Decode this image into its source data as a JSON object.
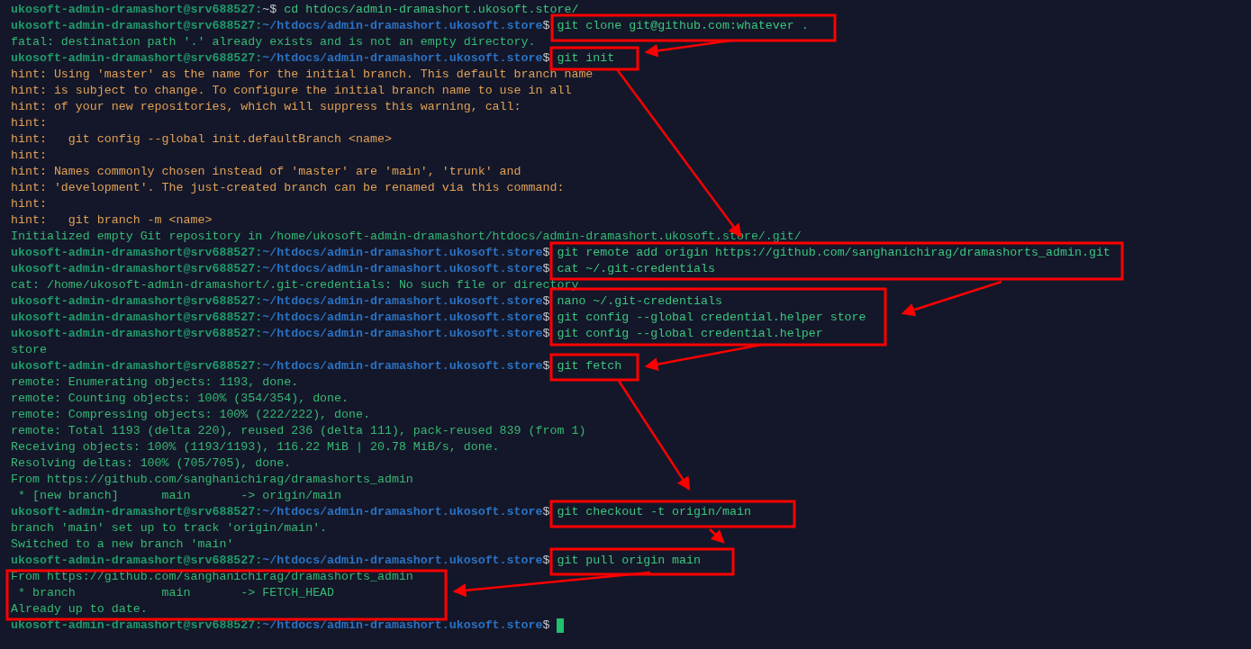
{
  "terminal": {
    "lines": [
      {
        "kind": "prompt",
        "user": "ukosoft-admin-dramashort@srv688527:",
        "path": "~",
        "symbol": "$",
        "command": "cd htdocs/admin-dramashort.ukosoft.store/"
      },
      {
        "kind": "prompt",
        "user": "ukosoft-admin-dramashort@srv688527:",
        "path": "~/htdocs/admin-dramashort.ukosoft.store",
        "symbol": "$",
        "command": "git clone git@github.com:whatever ."
      },
      {
        "kind": "output",
        "text": "fatal: destination path '.' already exists and is not an empty directory."
      },
      {
        "kind": "prompt",
        "user": "ukosoft-admin-dramashort@srv688527:",
        "path": "~/htdocs/admin-dramashort.ukosoft.store",
        "symbol": "$",
        "command": "git init"
      },
      {
        "kind": "hint",
        "text": "hint: Using 'master' as the name for the initial branch. This default branch name"
      },
      {
        "kind": "hint",
        "text": "hint: is subject to change. To configure the initial branch name to use in all"
      },
      {
        "kind": "hint",
        "text": "hint: of your new repositories, which will suppress this warning, call:"
      },
      {
        "kind": "hint",
        "text": "hint:"
      },
      {
        "kind": "hint",
        "text": "hint:   git config --global init.defaultBranch <name>"
      },
      {
        "kind": "hint",
        "text": "hint:"
      },
      {
        "kind": "hint",
        "text": "hint: Names commonly chosen instead of 'master' are 'main', 'trunk' and"
      },
      {
        "kind": "hint",
        "text": "hint: 'development'. The just-created branch can be renamed via this command:"
      },
      {
        "kind": "hint",
        "text": "hint:"
      },
      {
        "kind": "hint",
        "text": "hint:   git branch -m <name>"
      },
      {
        "kind": "output",
        "text": "Initialized empty Git repository in /home/ukosoft-admin-dramashort/htdocs/admin-dramashort.ukosoft.store/.git/"
      },
      {
        "kind": "prompt",
        "user": "ukosoft-admin-dramashort@srv688527:",
        "path": "~/htdocs/admin-dramashort.ukosoft.store",
        "symbol": "$",
        "command": "git remote add origin https://github.com/sanghanichirag/dramashorts_admin.git"
      },
      {
        "kind": "prompt",
        "user": "ukosoft-admin-dramashort@srv688527:",
        "path": "~/htdocs/admin-dramashort.ukosoft.store",
        "symbol": "$",
        "command": "cat ~/.git-credentials"
      },
      {
        "kind": "output",
        "text": "cat: /home/ukosoft-admin-dramashort/.git-credentials: No such file or directory"
      },
      {
        "kind": "prompt",
        "user": "ukosoft-admin-dramashort@srv688527:",
        "path": "~/htdocs/admin-dramashort.ukosoft.store",
        "symbol": "$",
        "command": "nano ~/.git-credentials"
      },
      {
        "kind": "prompt",
        "user": "ukosoft-admin-dramashort@srv688527:",
        "path": "~/htdocs/admin-dramashort.ukosoft.store",
        "symbol": "$",
        "command": "git config --global credential.helper store"
      },
      {
        "kind": "prompt",
        "user": "ukosoft-admin-dramashort@srv688527:",
        "path": "~/htdocs/admin-dramashort.ukosoft.store",
        "symbol": "$",
        "command": "git config --global credential.helper"
      },
      {
        "kind": "output",
        "text": "store"
      },
      {
        "kind": "prompt",
        "user": "ukosoft-admin-dramashort@srv688527:",
        "path": "~/htdocs/admin-dramashort.ukosoft.store",
        "symbol": "$",
        "command": "git fetch"
      },
      {
        "kind": "output",
        "text": "remote: Enumerating objects: 1193, done."
      },
      {
        "kind": "output",
        "text": "remote: Counting objects: 100% (354/354), done."
      },
      {
        "kind": "output",
        "text": "remote: Compressing objects: 100% (222/222), done."
      },
      {
        "kind": "output",
        "text": "remote: Total 1193 (delta 220), reused 236 (delta 111), pack-reused 839 (from 1)"
      },
      {
        "kind": "output",
        "text": "Receiving objects: 100% (1193/1193), 116.22 MiB | 20.78 MiB/s, done."
      },
      {
        "kind": "output",
        "text": "Resolving deltas: 100% (705/705), done."
      },
      {
        "kind": "output",
        "text": "From https://github.com/sanghanichirag/dramashorts_admin"
      },
      {
        "kind": "output",
        "text": " * [new branch]      main       -> origin/main"
      },
      {
        "kind": "prompt",
        "user": "ukosoft-admin-dramashort@srv688527:",
        "path": "~/htdocs/admin-dramashort.ukosoft.store",
        "symbol": "$",
        "command": "git checkout -t origin/main"
      },
      {
        "kind": "output",
        "text": "branch 'main' set up to track 'origin/main'."
      },
      {
        "kind": "output",
        "text": "Switched to a new branch 'main'"
      },
      {
        "kind": "prompt",
        "user": "ukosoft-admin-dramashort@srv688527:",
        "path": "~/htdocs/admin-dramashort.ukosoft.store",
        "symbol": "$",
        "command": "git pull origin main"
      },
      {
        "kind": "output",
        "text": "From https://github.com/sanghanichirag/dramashorts_admin"
      },
      {
        "kind": "output",
        "text": " * branch            main       -> FETCH_HEAD"
      },
      {
        "kind": "output",
        "text": "Already up to date."
      },
      {
        "kind": "prompt",
        "user": "ukosoft-admin-dramashort@srv688527:",
        "path": "~/htdocs/admin-dramashort.ukosoft.store",
        "symbol": "$",
        "cursor": true
      }
    ]
  }
}
